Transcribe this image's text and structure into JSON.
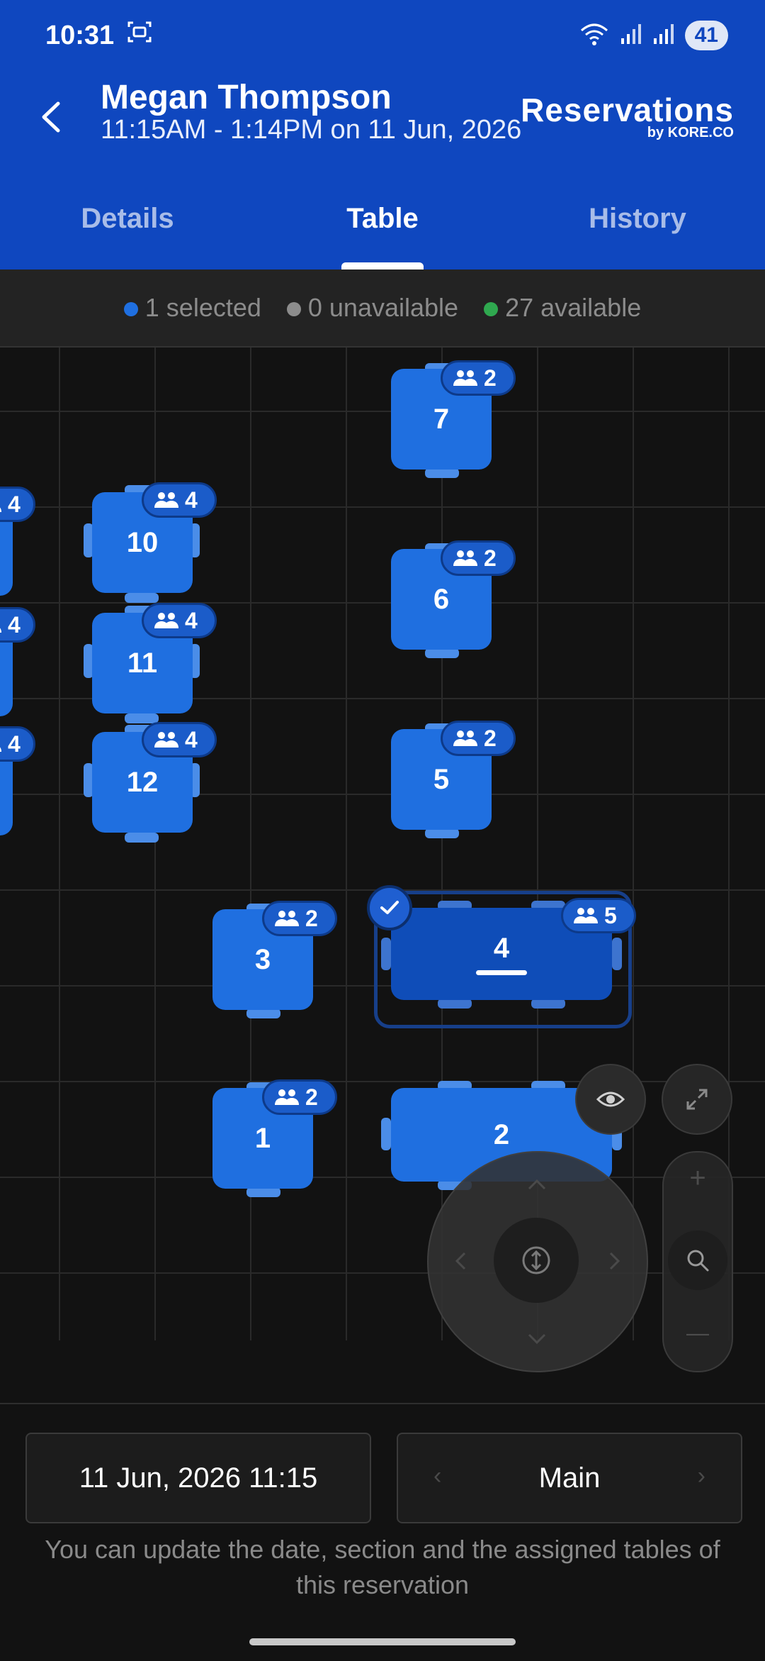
{
  "status_bar": {
    "time": "10:31",
    "battery": "41"
  },
  "header": {
    "guest_name": "Megan Thompson",
    "time_range": "11:15AM - 1:14PM on 11 Jun, 2026",
    "brand_name": "Reservations",
    "brand_sub": "by KORE.CO"
  },
  "tabs": [
    {
      "label": "Details",
      "active": false
    },
    {
      "label": "Table",
      "active": true
    },
    {
      "label": "History",
      "active": false
    }
  ],
  "legend": {
    "selected": "1 selected",
    "unavailable": "0 unavailable",
    "available": "27 available",
    "colors": {
      "selected": "#1f6fe0",
      "unavailable": "#8c8c8c",
      "available": "#2fa84f"
    }
  },
  "tables": {
    "t7": {
      "number": "7",
      "capacity": "2"
    },
    "t6": {
      "number": "6",
      "capacity": "2"
    },
    "t5": {
      "number": "5",
      "capacity": "2"
    },
    "t10": {
      "number": "10",
      "capacity": "4"
    },
    "t11": {
      "number": "11",
      "capacity": "4"
    },
    "t12": {
      "number": "12",
      "capacity": "4"
    },
    "edge_a": {
      "capacity": "4"
    },
    "edge_b": {
      "capacity": "4"
    },
    "edge_c": {
      "capacity": "4"
    },
    "t3": {
      "number": "3",
      "capacity": "2"
    },
    "t4": {
      "number": "4",
      "capacity": "5",
      "selected": true
    },
    "t1": {
      "number": "1",
      "capacity": "2"
    },
    "t2": {
      "number": "2"
    }
  },
  "controls": {
    "icons": [
      "eye-icon",
      "expand-icon",
      "plus-icon",
      "search-icon",
      "minus-icon",
      "move-icon"
    ],
    "zoom_in": "+",
    "zoom_out": "—"
  },
  "footer": {
    "date_value": "11 Jun, 2026 11:15",
    "section_value": "Main",
    "section_prev": "‹",
    "section_next": "›",
    "hint": "You can update the date, section and the assigned tables of this reservation"
  }
}
